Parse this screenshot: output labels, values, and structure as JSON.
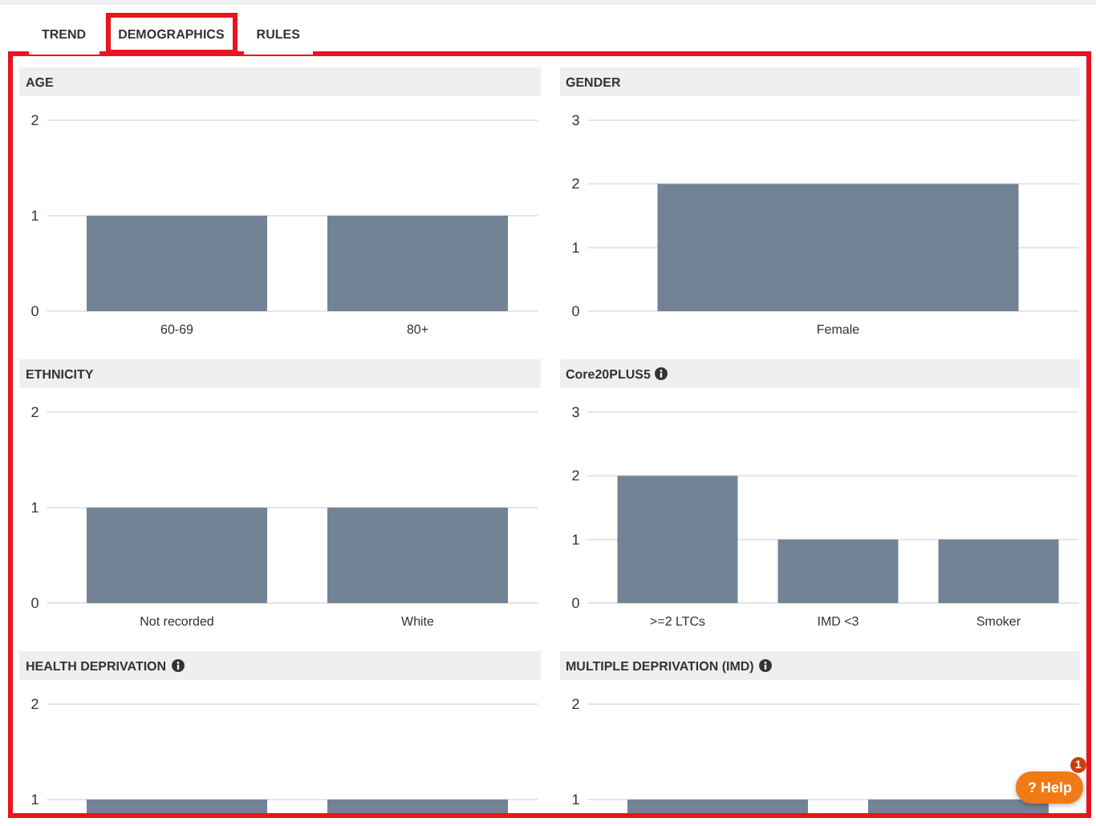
{
  "tabs": [
    {
      "label": "TREND",
      "selected": false
    },
    {
      "label": "DEMOGRAPHICS",
      "selected": true
    },
    {
      "label": "RULES",
      "selected": false
    }
  ],
  "panels": [
    {
      "title": "AGE",
      "info": false,
      "chart_data": {
        "type": "bar",
        "categories": [
          "60-69",
          "80+"
        ],
        "values": [
          1,
          1
        ],
        "ylim": [
          0,
          2
        ],
        "yticks": [
          0,
          1,
          2
        ]
      }
    },
    {
      "title": "GENDER",
      "info": false,
      "chart_data": {
        "type": "bar",
        "categories": [
          "Female"
        ],
        "values": [
          2
        ],
        "ylim": [
          0,
          3
        ],
        "yticks": [
          0,
          1,
          2,
          3
        ]
      }
    },
    {
      "title": "ETHNICITY",
      "info": false,
      "chart_data": {
        "type": "bar",
        "categories": [
          "Not recorded",
          "White"
        ],
        "values": [
          1,
          1
        ],
        "ylim": [
          0,
          2
        ],
        "yticks": [
          0,
          1,
          2
        ]
      }
    },
    {
      "title": "Core20PLUS5",
      "info": true,
      "chart_data": {
        "type": "bar",
        "categories": [
          ">=2 LTCs",
          "IMD <3",
          "Smoker"
        ],
        "values": [
          2,
          1,
          1
        ],
        "ylim": [
          0,
          3
        ],
        "yticks": [
          0,
          1,
          2,
          3
        ]
      }
    },
    {
      "title": "HEALTH DEPRIVATION",
      "info": true,
      "chart_data": {
        "type": "bar",
        "values": [
          1,
          1
        ],
        "ylim": [
          0,
          2
        ],
        "yticks": [
          1,
          2
        ]
      }
    },
    {
      "title": "MULTIPLE DEPRIVATION (IMD)",
      "info": true,
      "chart_data": {
        "type": "bar",
        "values": [
          1,
          1
        ],
        "ylim": [
          0,
          2
        ],
        "yticks": [
          1,
          2
        ]
      }
    }
  ],
  "help": {
    "label": "? Help",
    "badge": "1"
  }
}
